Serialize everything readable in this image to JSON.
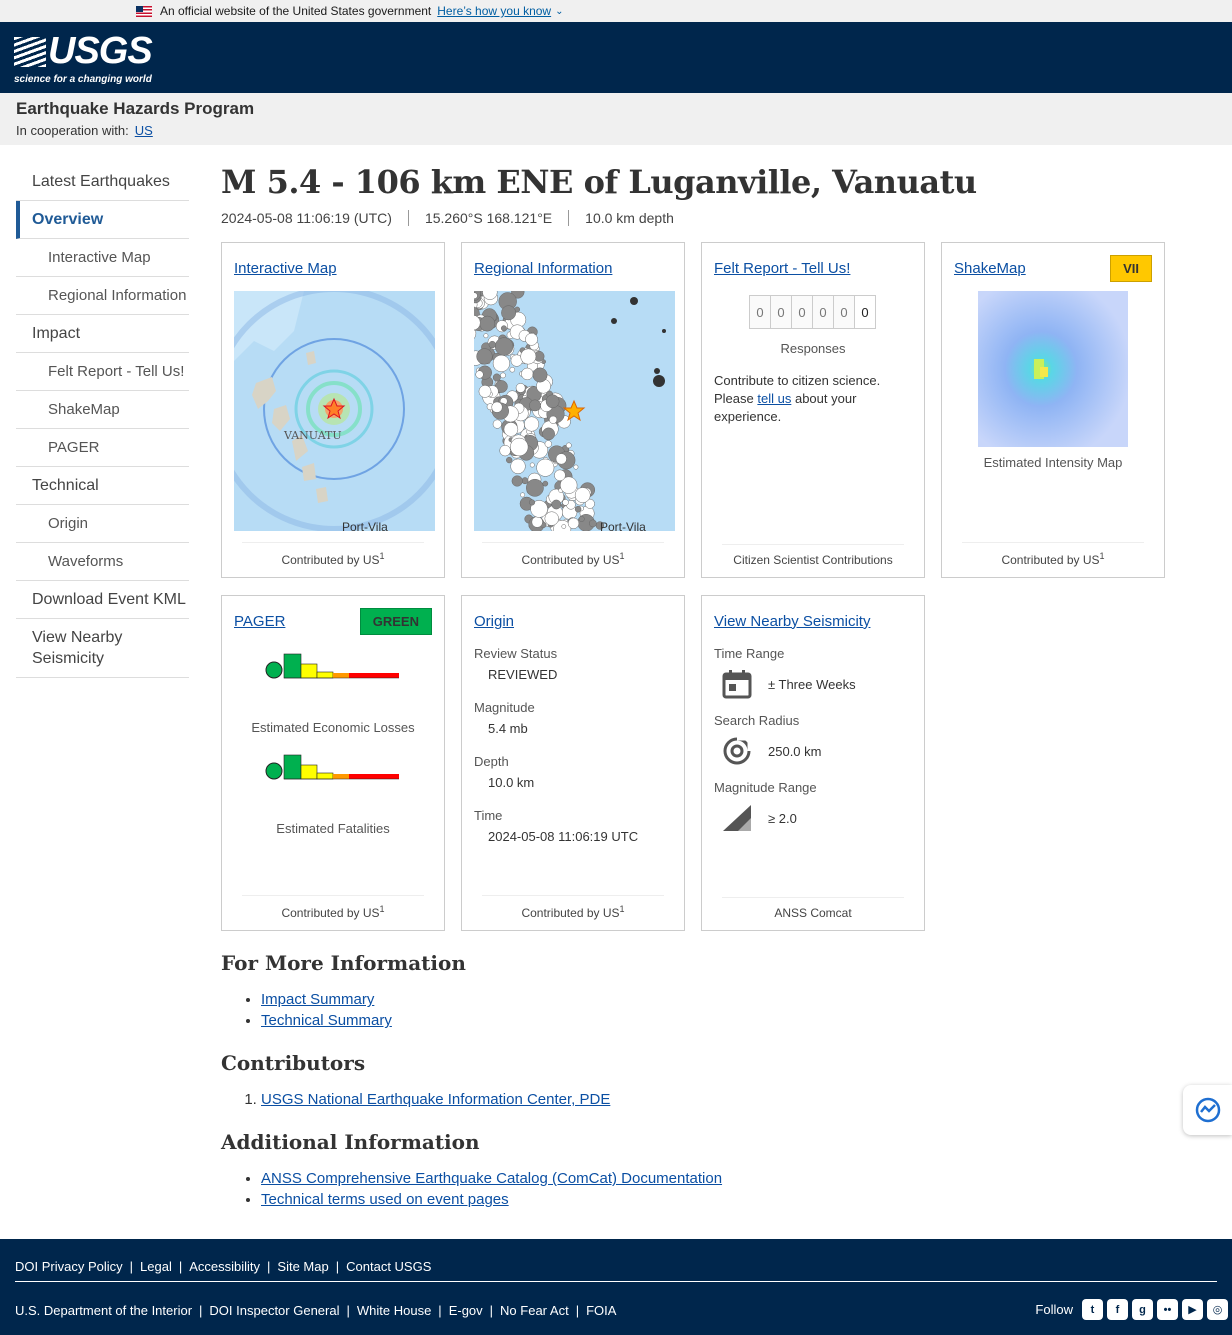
{
  "gov_banner": {
    "text": "An official website of the United States government",
    "link": "Here’s how you know"
  },
  "logo": {
    "name": "USGS",
    "tagline": "science for a changing world"
  },
  "program": {
    "title": "Earthquake Hazards Program",
    "coop_label": "In cooperation with:",
    "coop_link": "US"
  },
  "sidebar": [
    {
      "label": "Latest Earthquakes",
      "type": "top"
    },
    {
      "label": "Overview",
      "type": "active"
    },
    {
      "label": "Interactive Map",
      "type": "sub"
    },
    {
      "label": "Regional Information",
      "type": "sub"
    },
    {
      "label": "Impact",
      "type": "top"
    },
    {
      "label": "Felt Report - Tell Us!",
      "type": "sub"
    },
    {
      "label": "ShakeMap",
      "type": "sub"
    },
    {
      "label": "PAGER",
      "type": "sub"
    },
    {
      "label": "Technical",
      "type": "top"
    },
    {
      "label": "Origin",
      "type": "sub"
    },
    {
      "label": "Waveforms",
      "type": "sub"
    },
    {
      "label": "Download Event KML",
      "type": "top"
    },
    {
      "label": "View Nearby Seismicity",
      "type": "top"
    }
  ],
  "event": {
    "title": "M 5.4 - 106 km ENE of Luganville, Vanuatu",
    "time": "2024-05-08 11:06:19 (UTC)",
    "coords": "15.260°S 168.121°E",
    "depth": "10.0 km depth"
  },
  "cards": {
    "contrib_prefix": "Contributed by",
    "contrib_code": "US",
    "contrib_sup": "1",
    "interactive_map": {
      "title": "Interactive Map",
      "map_labels": [
        "VANUATU",
        "Port-Vila"
      ]
    },
    "regional": {
      "title": "Regional Information",
      "map_label": "Port-Vila"
    },
    "felt": {
      "title": "Felt Report - Tell Us!",
      "digits": [
        "0",
        "0",
        "0",
        "0",
        "0",
        "0"
      ],
      "responses": "Responses",
      "text1": "Contribute to citizen science. Please",
      "link": "tell us",
      "text2": "about your experience.",
      "footer": "Citizen Scientist Contributions"
    },
    "shakemap": {
      "title": "ShakeMap",
      "badge": "VII",
      "badge_color": "#ffc800",
      "caption": "Estimated Intensity Map"
    },
    "pager": {
      "title": "PAGER",
      "badge": "GREEN",
      "badge_color": "#00b04f",
      "losses_caption": "Estimated Economic Losses",
      "fatalities_caption": "Estimated Fatalities"
    },
    "origin": {
      "title": "Origin",
      "review_label": "Review Status",
      "review_value": "REVIEWED",
      "mag_label": "Magnitude",
      "mag_value": "5.4 mb",
      "depth_label": "Depth",
      "depth_value": "10.0 km",
      "time_label": "Time",
      "time_value": "2024-05-08 11:06:19 UTC"
    },
    "nearby": {
      "title": "View Nearby Seismicity",
      "time_label": "Time Range",
      "time_value": "± Three Weeks",
      "radius_label": "Search Radius",
      "radius_value": "250.0 km",
      "mag_label": "Magnitude Range",
      "mag_value": "≥ 2.0",
      "footer": "ANSS Comcat"
    }
  },
  "more_info": {
    "title": "For More Information",
    "links": [
      "Impact Summary",
      "Technical Summary"
    ]
  },
  "contributors": {
    "title": "Contributors",
    "items": [
      "USGS National Earthquake Information Center, PDE"
    ]
  },
  "additional": {
    "title": "Additional Information",
    "links": [
      "ANSS Comprehensive Earthquake Catalog (ComCat) Documentation",
      "Technical terms used on event pages"
    ]
  },
  "footer": {
    "row1": [
      "DOI Privacy Policy",
      "Legal",
      "Accessibility",
      "Site Map",
      "Contact USGS"
    ],
    "row2": [
      "U.S. Department of the Interior",
      "DOI Inspector General",
      "White House",
      "E-gov",
      "No Fear Act",
      "FOIA"
    ],
    "follow": "Follow",
    "social": [
      "twitter-icon",
      "facebook-icon",
      "github-icon",
      "flickr-icon",
      "youtube-icon",
      "instagram-icon"
    ]
  }
}
